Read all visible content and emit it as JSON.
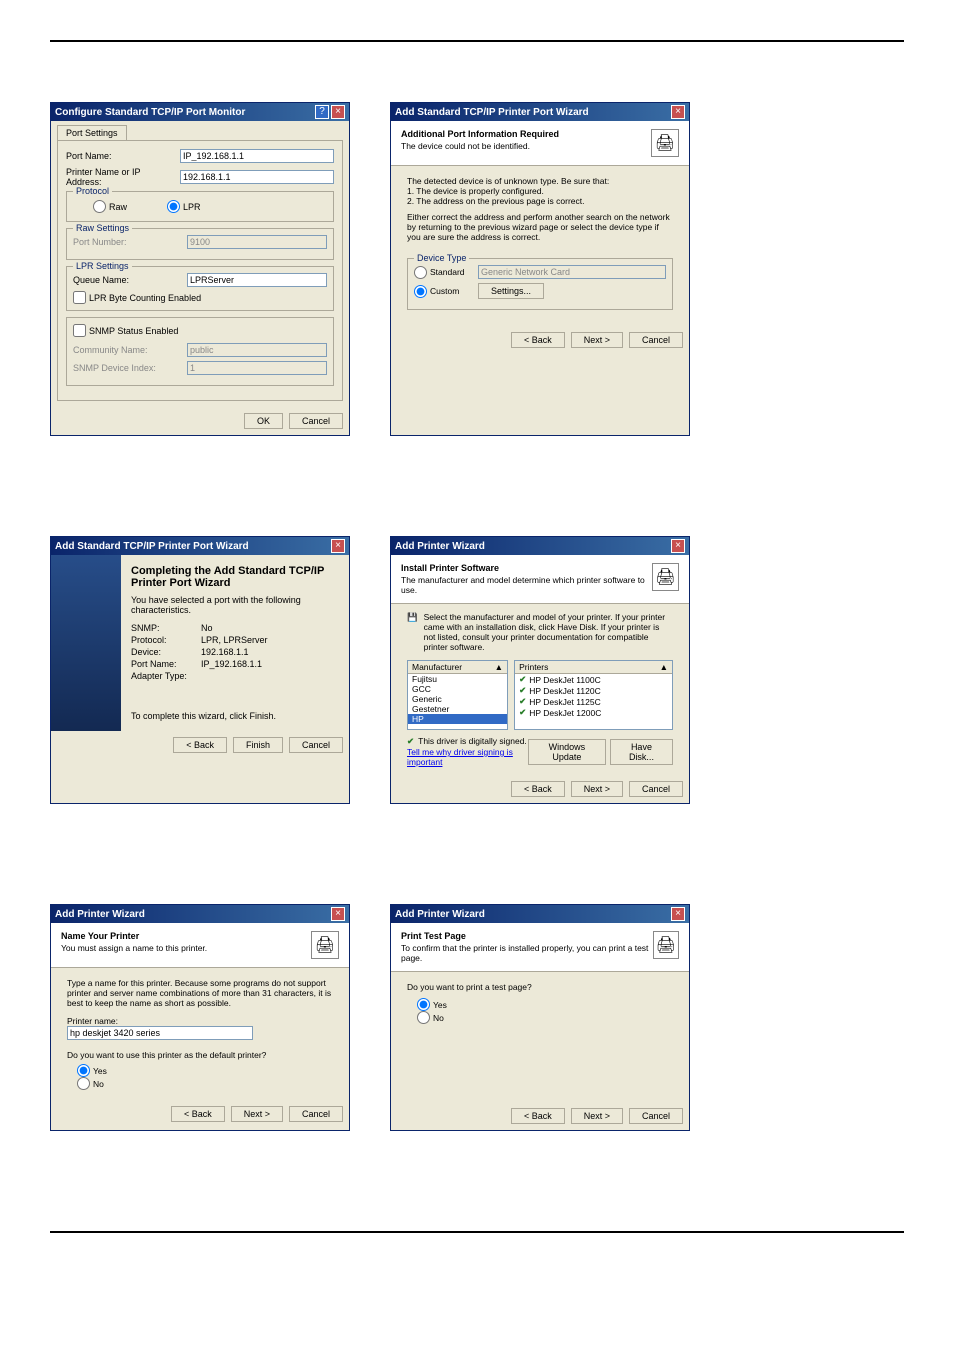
{
  "d1": {
    "title": "Configure Standard TCP/IP Port Monitor",
    "tab": "Port Settings",
    "portNameLbl": "Port Name:",
    "portName": "IP_192.168.1.1",
    "addrLbl": "Printer Name or IP Address:",
    "addr": "192.168.1.1",
    "protoGrp": "Protocol",
    "raw": "Raw",
    "lpr": "LPR",
    "rawGrp": "Raw Settings",
    "portNumLbl": "Port Number:",
    "portNum": "9100",
    "lprGrp": "LPR Settings",
    "queueLbl": "Queue Name:",
    "queue": "LPRServer",
    "lprByte": "LPR Byte Counting Enabled",
    "snmpEn": "SNMP Status Enabled",
    "commLbl": "Community Name:",
    "comm": "public",
    "devIdxLbl": "SNMP Device Index:",
    "devIdx": "1",
    "ok": "OK",
    "cancel": "Cancel"
  },
  "d2": {
    "title": "Add Standard TCP/IP Printer Port Wizard",
    "h1": "Additional Port Information Required",
    "h2": "The device could not be identified.",
    "p1": "The detected device is of unknown type. Be sure that:",
    "p2": "1. The device is properly configured.",
    "p3": "2. The address on the previous page is correct.",
    "p4": "Either correct the address and perform another search on the network by returning to the previous wizard page or select the device type if you are sure the address is correct.",
    "grp": "Device Type",
    "std": "Standard",
    "stdVal": "Generic Network Card",
    "custom": "Custom",
    "settings": "Settings...",
    "back": "< Back",
    "next": "Next >",
    "cancel": "Cancel"
  },
  "d3": {
    "title": "Add Standard TCP/IP Printer Port Wizard",
    "big": "Completing the Add Standard TCP/IP Printer Port Wizard",
    "p1": "You have selected a port with the following characteristics.",
    "k1": "SNMP:",
    "v1": "No",
    "k2": "Protocol:",
    "v2": "LPR, LPRServer",
    "k3": "Device:",
    "v3": "192.168.1.1",
    "k4": "Port Name:",
    "v4": "IP_192.168.1.1",
    "k5": "Adapter Type:",
    "v5": "",
    "p2": "To complete this wizard, click Finish.",
    "back": "< Back",
    "finish": "Finish",
    "cancel": "Cancel"
  },
  "d4": {
    "title": "Add Printer Wizard",
    "h1": "Install Printer Software",
    "h2": "The manufacturer and model determine which printer software to use.",
    "p1": "Select the manufacturer and model of your printer. If your printer came with an installation disk, click Have Disk. If your printer is not listed, consult your printer documentation for compatible printer software.",
    "mfr": "Manufacturer",
    "prn": "Printers",
    "m1": "Fujitsu",
    "m2": "GCC",
    "m3": "Generic",
    "m4": "Gestetner",
    "m5": "HP",
    "p_1": "HP DeskJet 1100C",
    "p_2": "HP DeskJet 1120C",
    "p_3": "HP DeskJet 1125C",
    "p_4": "HP DeskJet 1200C",
    "signed": "This driver is digitally signed.",
    "tell": "Tell me why driver signing is important",
    "wu": "Windows Update",
    "hd": "Have Disk...",
    "back": "< Back",
    "next": "Next >",
    "cancel": "Cancel"
  },
  "d5": {
    "title": "Add Printer Wizard",
    "h1": "Name Your Printer",
    "h2": "You must assign a name to this printer.",
    "p1": "Type a name for this printer. Because some programs do not support printer and server name combinations of more than 31 characters, it is best to keep the name as short as possible.",
    "nameLbl": "Printer name:",
    "name": "hp deskjet 3420 series",
    "q": "Do you want to use this printer as the default printer?",
    "yes": "Yes",
    "no": "No",
    "back": "< Back",
    "next": "Next >",
    "cancel": "Cancel"
  },
  "d6": {
    "title": "Add Printer Wizard",
    "h1": "Print Test Page",
    "h2": "To confirm that the printer is installed properly, you can print a test page.",
    "q": "Do you want to print a test page?",
    "yes": "Yes",
    "no": "No",
    "back": "< Back",
    "next": "Next >",
    "cancel": "Cancel"
  }
}
